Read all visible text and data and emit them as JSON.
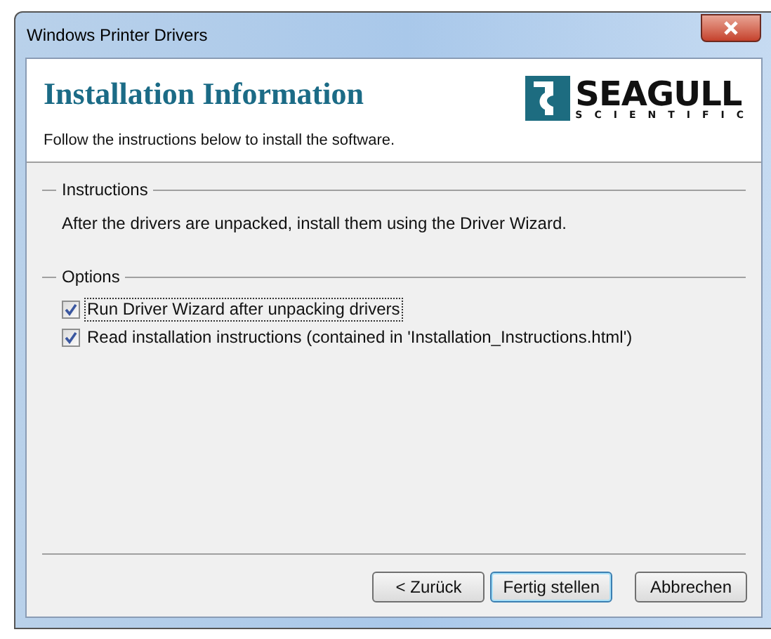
{
  "window": {
    "title": "Windows Printer Drivers"
  },
  "header": {
    "title": "Installation Information",
    "subtitle": "Follow the instructions below to install the software.",
    "logo": {
      "name": "SEAGULL",
      "tagline": "SCIENTIFIC"
    }
  },
  "instructions": {
    "legend": "Instructions",
    "text": "After the drivers are unpacked, install them using the Driver Wizard."
  },
  "options": {
    "legend": "Options",
    "items": [
      {
        "label": "Run Driver Wizard after unpacking drivers",
        "checked": true,
        "focused": true
      },
      {
        "label": "Read installation instructions (contained in 'Installation_Instructions.html')",
        "checked": true,
        "focused": false
      }
    ]
  },
  "buttons": [
    {
      "label": "< Zurück",
      "default": false
    },
    {
      "label": "Fertig stellen",
      "default": true
    },
    {
      "label": "Abbrechen",
      "default": false
    }
  ]
}
